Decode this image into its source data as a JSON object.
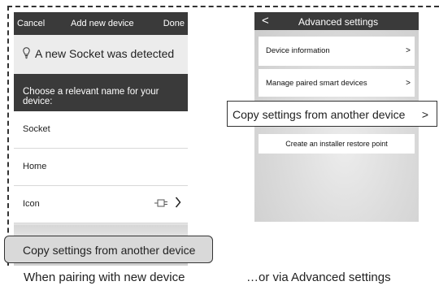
{
  "left_screen": {
    "header": {
      "cancel": "Cancel",
      "title": "Add new device",
      "done": "Done"
    },
    "detected_message": "A new Socket was detected",
    "choose_prompt": "Choose a relevant name for your device:",
    "options": [
      {
        "label": "Socket"
      },
      {
        "label": "Home"
      },
      {
        "label": "Icon"
      }
    ],
    "icon_option_chevron": ">",
    "copy_button": "Copy settings from another device"
  },
  "right_screen": {
    "header": {
      "back": "<",
      "title": "Advanced settings"
    },
    "items": [
      {
        "label": "Device information",
        "chevron": ">"
      },
      {
        "label": "Manage paired smart devices",
        "chevron": ">"
      }
    ],
    "copy_button": {
      "label": "Copy settings from another device",
      "chevron": ">"
    },
    "restore_button": "Create an installer restore point"
  },
  "captions": {
    "left": "When pairing with new device",
    "right": "…or via Advanced settings"
  }
}
